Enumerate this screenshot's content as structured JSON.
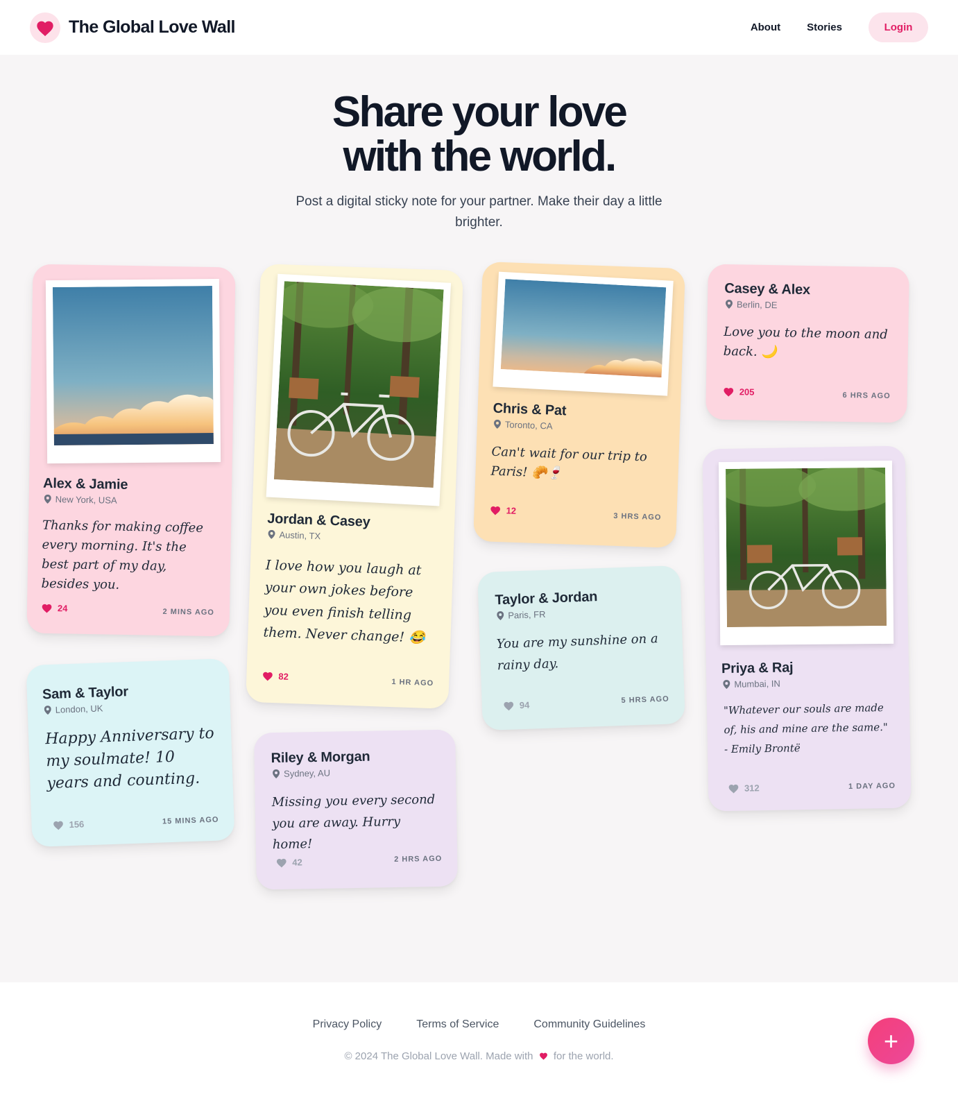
{
  "header": {
    "brand": "The Global Love Wall",
    "nav": [
      "About",
      "Stories"
    ],
    "login": "Login"
  },
  "hero": {
    "title_line1": "Share your love",
    "title_line2": "with the world.",
    "subtitle": "Post a digital sticky note for your partner. Make their day a little brighter."
  },
  "notes": [
    {
      "names": "Alex & Jamie",
      "location": "New York, USA",
      "message": "Thanks for making coffee every morning. It's the best part of my day, besides you.",
      "likes": "24",
      "time": "2 MINS AGO",
      "liked": true,
      "color": "pink",
      "photo": "sky"
    },
    {
      "names": "Jordan & Casey",
      "location": "Austin, TX",
      "message": "I love how you laugh at your own jokes before you even finish telling them. Never change! 😂",
      "likes": "82",
      "time": "1 HR AGO",
      "liked": true,
      "color": "yellow",
      "photo": "bikes"
    },
    {
      "names": "Chris & Pat",
      "location": "Toronto, CA",
      "message": "Can't wait for our trip to Paris! 🥐🍷",
      "likes": "12",
      "time": "3 HRS AGO",
      "liked": true,
      "color": "orange",
      "photo": "sky"
    },
    {
      "names": "Casey & Alex",
      "location": "Berlin, DE",
      "message": "Love you to the moon and back. 🌙",
      "likes": "205",
      "time": "6 HRS AGO",
      "liked": true,
      "color": "pink"
    },
    {
      "names": "Sam & Taylor",
      "location": "London, UK",
      "message": "Happy Anniversary to my soulmate! 10 years and counting.",
      "likes": "156",
      "time": "15 MINS AGO",
      "liked": false,
      "color": "cyan"
    },
    {
      "names": "Riley & Morgan",
      "location": "Sydney, AU",
      "message": "Missing you every second you are away. Hurry home!",
      "likes": "42",
      "time": "2 HRS AGO",
      "liked": false,
      "color": "lilac"
    },
    {
      "names": "Taylor & Jordan",
      "location": "Paris, FR",
      "message": "You are my sunshine on a rainy day.",
      "likes": "94",
      "time": "5 HRS AGO",
      "liked": false,
      "color": "mint"
    },
    {
      "names": "Priya & Raj",
      "location": "Mumbai, IN",
      "message": "\"Whatever our souls are made of, his and mine are the same.\" - Emily Brontë",
      "likes": "312",
      "time": "1 DAY AGO",
      "liked": false,
      "color": "lilac",
      "photo": "bikes"
    }
  ],
  "footer": {
    "links": [
      "Privacy Policy",
      "Terms of Service",
      "Community Guidelines"
    ],
    "copy_before": "© 2024 The Global Love Wall. Made with",
    "copy_after": "for the world."
  },
  "fab": {
    "label": "+"
  },
  "colors": {
    "accent": "#e11d64",
    "pink": "#fdd6e0",
    "yellow": "#fdf6d9",
    "orange": "#fde0b4",
    "cyan": "#dcf4f6",
    "mint": "#dcf0ef",
    "lilac": "#ede1f3"
  }
}
